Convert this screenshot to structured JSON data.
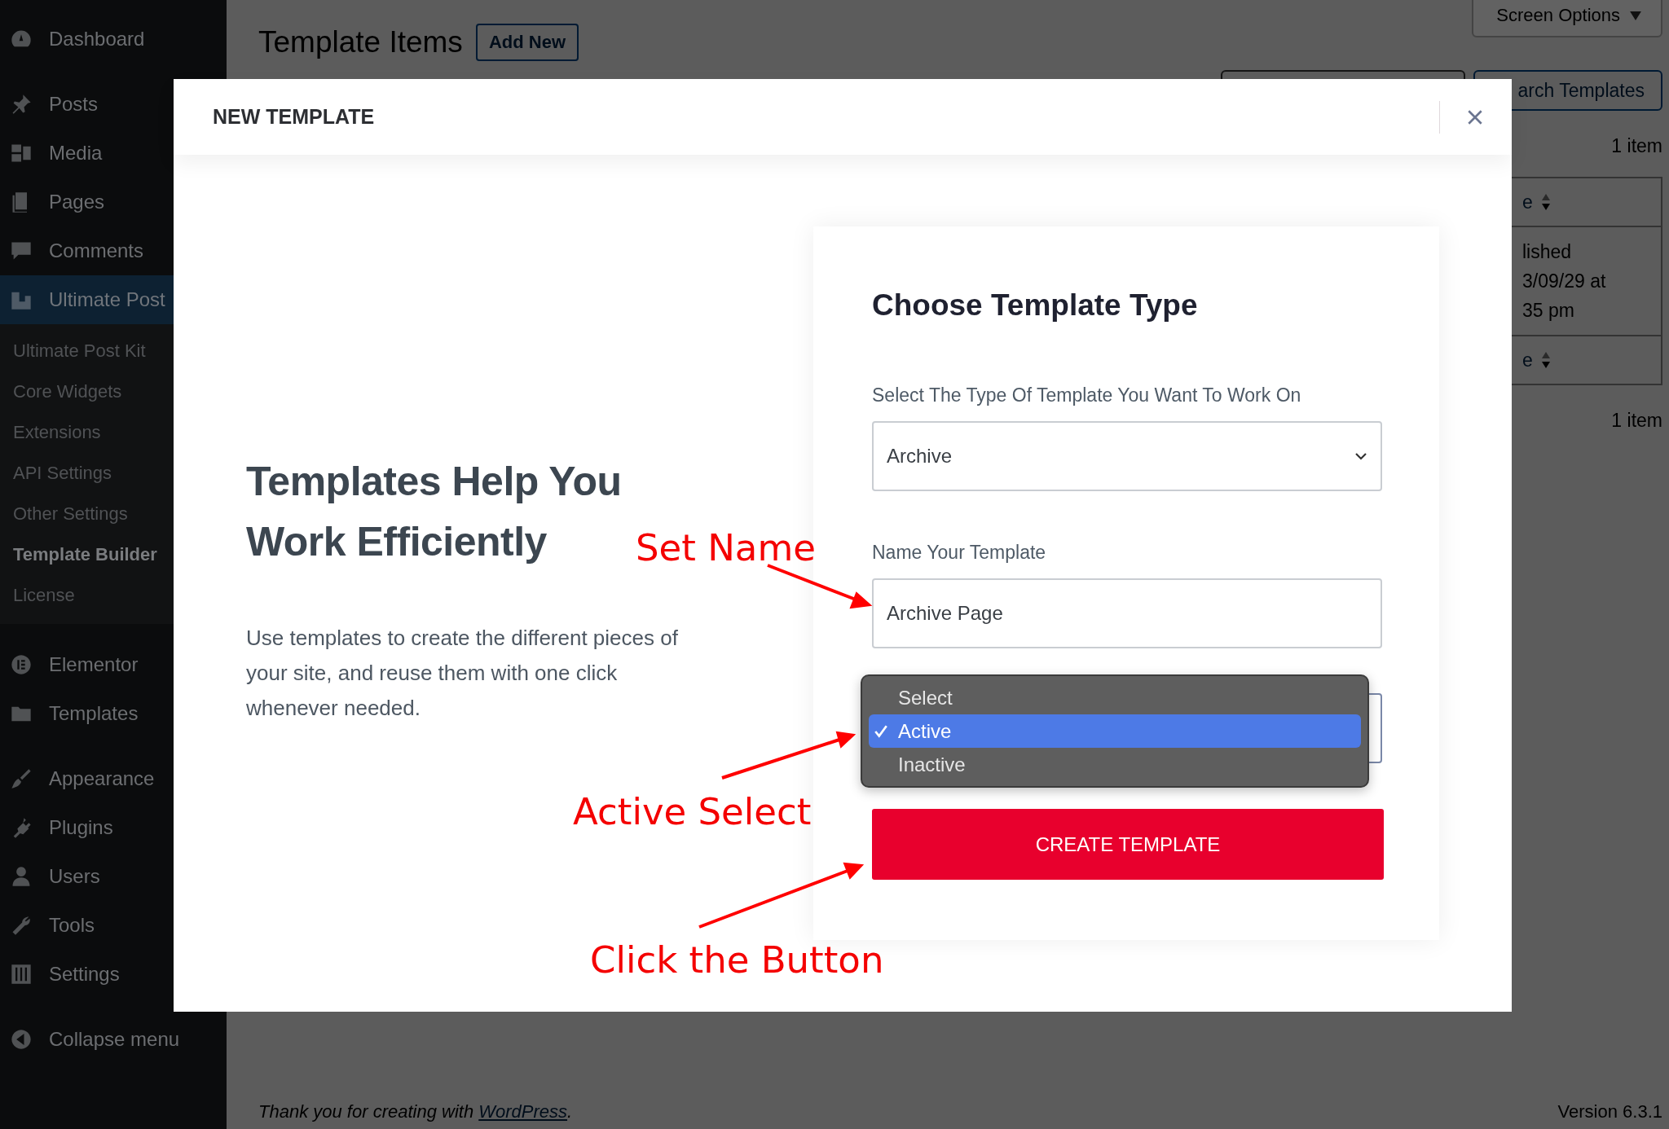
{
  "sidebar": {
    "sections": [
      [
        {
          "label": "Dashboard",
          "selected": false
        }
      ],
      [
        {
          "label": "Posts",
          "selected": false
        },
        {
          "label": "Media",
          "selected": false
        },
        {
          "label": "Pages",
          "selected": false
        },
        {
          "label": "Comments",
          "selected": false
        },
        {
          "label": "Ultimate Post",
          "selected": true,
          "children": [
            {
              "label": "Ultimate Post Kit",
              "selected": false
            },
            {
              "label": "Core Widgets",
              "selected": false
            },
            {
              "label": "Extensions",
              "selected": false
            },
            {
              "label": "API Settings",
              "selected": false
            },
            {
              "label": "Other Settings",
              "selected": false
            },
            {
              "label": "Template Builder",
              "selected": true
            },
            {
              "label": "License",
              "selected": false
            }
          ]
        }
      ],
      [
        {
          "label": "Elementor",
          "selected": false
        },
        {
          "label": "Templates",
          "selected": false
        }
      ],
      [
        {
          "label": "Appearance",
          "selected": false
        },
        {
          "label": "Plugins",
          "selected": false
        },
        {
          "label": "Users",
          "selected": false
        },
        {
          "label": "Tools",
          "selected": false
        },
        {
          "label": "Settings",
          "selected": false
        }
      ],
      [
        {
          "label": "Collapse menu",
          "selected": false
        }
      ]
    ]
  },
  "page_header": {
    "title": "Template Items",
    "add_new": "Add New",
    "screen_options": "Screen Options"
  },
  "search": {
    "button": "arch Templates"
  },
  "item_counts": [
    "1 item",
    "1 item"
  ],
  "table": {
    "header_cell": "e",
    "row_lines": [
      "lished",
      "3/09/29 at",
      "35 pm"
    ],
    "footer_cell": "e"
  },
  "footer": {
    "text": "Thank you for creating with ",
    "link": "WordPress",
    "after": ".",
    "version": "Version 6.3.1"
  },
  "modal": {
    "title": "NEW TEMPLATE",
    "intro": {
      "heading": "Templates Help You Work Efficiently",
      "text": "Use templates to create the different pieces of your site, and reuse them with one click whenever needed."
    },
    "card": {
      "title": "Choose Template Type",
      "type_label": "Select The Type Of Template You Want To Work On",
      "type_value": "Archive",
      "name_label": "Name Your Template",
      "name_value": "Archive Page",
      "status_options": [
        {
          "label": "Select",
          "selected": false
        },
        {
          "label": "Active",
          "selected": true
        },
        {
          "label": "Inactive",
          "selected": false
        }
      ],
      "create_button": "CREATE TEMPLATE"
    }
  },
  "annotations": [
    {
      "text": "Set Name"
    },
    {
      "text": "Active Select"
    },
    {
      "text": "Click the Button"
    }
  ]
}
